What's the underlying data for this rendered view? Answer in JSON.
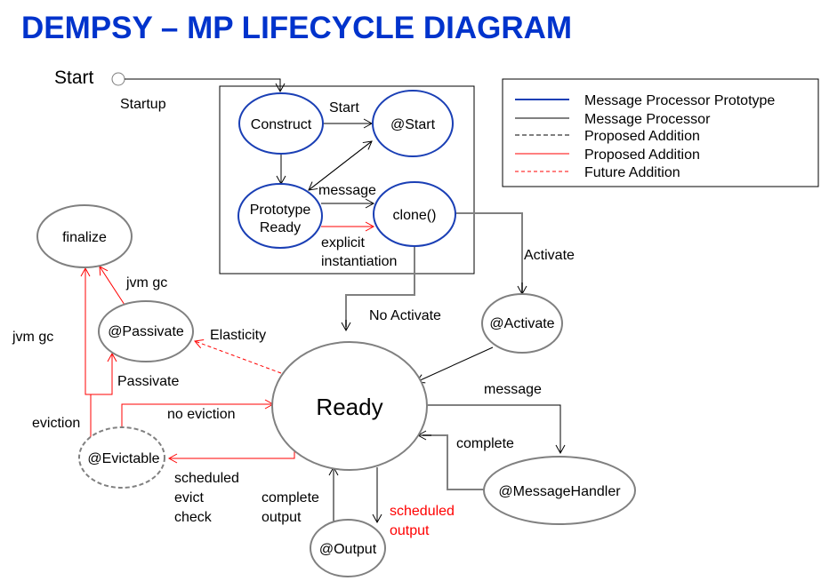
{
  "title": "DEMPSY – MP LIFECYCLE DIAGRAM",
  "colors": {
    "title": "#0033cc",
    "prototype": "#1a3fb5",
    "processor": "#808080",
    "proposed_red": "#ff0000",
    "edge": "#000000"
  },
  "start": {
    "label": "Start",
    "edge_label": "Startup"
  },
  "nodes": {
    "construct": "Construct",
    "at_start": "@Start",
    "prototype_ready_line1": "Prototype",
    "prototype_ready_line2": "Ready",
    "clone": "clone()",
    "finalize": "finalize",
    "passivate": "@Passivate",
    "activate": "@Activate",
    "ready": "Ready",
    "evictable": "@Evictable",
    "message_handler": "@MessageHandler",
    "output": "@Output"
  },
  "edge_labels": {
    "construct_to_start": "Start",
    "proto_to_clone_message": "message",
    "explicit_line1": "explicit",
    "explicit_line2": "instantiation",
    "activate": "Activate",
    "no_activate": "No Activate",
    "jvm_gc_passivate": "jvm gc",
    "jvm_gc_eviction": "jvm gc",
    "elasticity": "Elasticity",
    "passivate": "Passivate",
    "eviction": "eviction",
    "no_eviction": "no eviction",
    "sched_evict_line1": "scheduled",
    "sched_evict_line2": "evict",
    "sched_evict_line3": "check",
    "message": "message",
    "complete": "complete",
    "complete_output_line1": "complete",
    "complete_output_line2": "output",
    "scheduled_output_line1": "scheduled",
    "scheduled_output_line2": "output"
  },
  "legend": [
    {
      "label": "Message Processor Prototype",
      "style": "solid-blue"
    },
    {
      "label": "Message Processor",
      "style": "solid-gray"
    },
    {
      "label": "Proposed Addition",
      "style": "dashed-gray"
    },
    {
      "label": "Proposed Addition",
      "style": "solid-red"
    },
    {
      "label": "Future Addition",
      "style": "dashed-red"
    }
  ]
}
